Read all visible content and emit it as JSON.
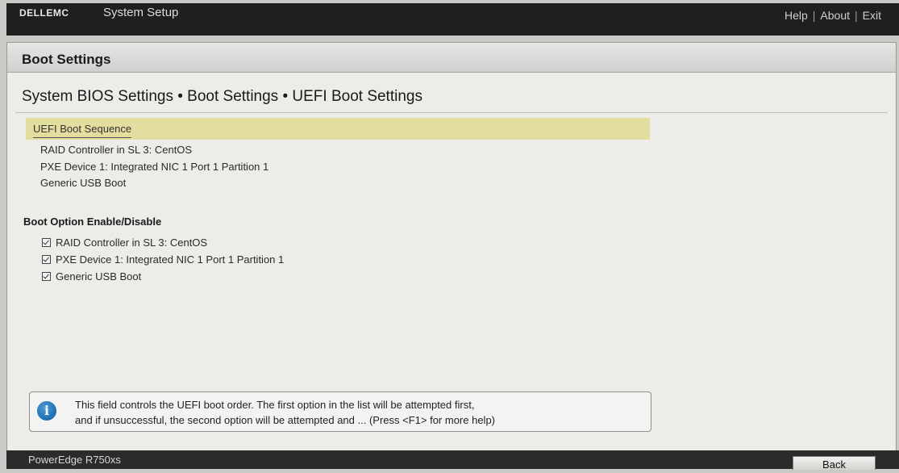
{
  "header": {
    "logo_text": "DELLEMC",
    "title": "System Setup",
    "links": [
      "Help",
      "About",
      "Exit"
    ],
    "separator": "|"
  },
  "page": {
    "heading": "Boot Settings",
    "breadcrumb": "System BIOS Settings • Boot Settings • UEFI Boot Settings"
  },
  "boot_sequence": {
    "header": "UEFI Boot Sequence",
    "items": [
      "RAID Controller in SL 3: CentOS",
      "PXE Device 1: Integrated NIC 1 Port 1 Partition 1",
      "Generic USB Boot"
    ]
  },
  "boot_options": {
    "title": "Boot Option Enable/Disable",
    "items": [
      {
        "label": "RAID Controller in SL 3: CentOS",
        "checked": true
      },
      {
        "label": "PXE Device 1: Integrated NIC 1 Port 1 Partition 1",
        "checked": true
      },
      {
        "label": "Generic USB Boot",
        "checked": true
      }
    ]
  },
  "help": {
    "icon": "info-icon",
    "line1": "This field controls the UEFI boot order. The first option in the list will be attempted first,",
    "line2": "and if unsuccessful, the second option will be attempted and ... (Press <F1> for more help)"
  },
  "footer": {
    "model": "PowerEdge R750xs",
    "back_label": "Back"
  }
}
